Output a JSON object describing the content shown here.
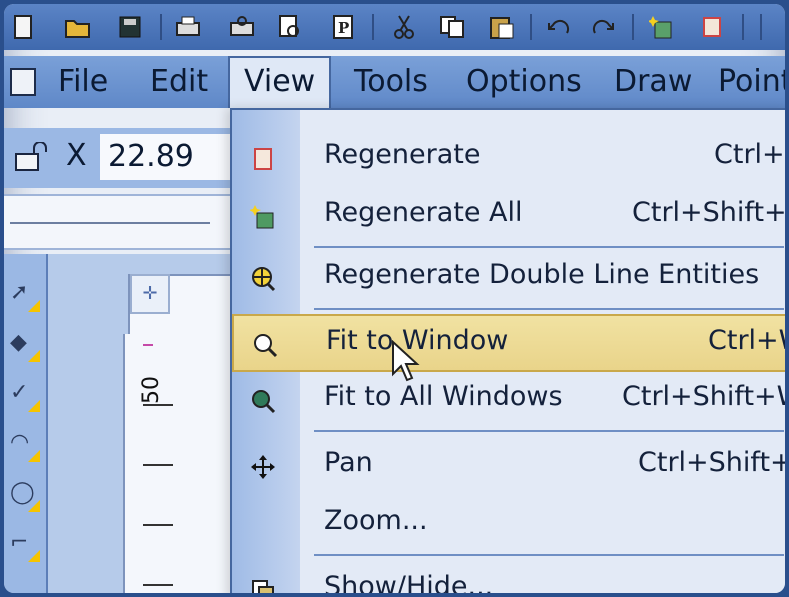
{
  "coordinate": {
    "axis": "X",
    "value": "22.89"
  },
  "menubar": {
    "items": [
      {
        "id": "file",
        "label": "File"
      },
      {
        "id": "edit",
        "label": "Edit"
      },
      {
        "id": "view",
        "label": "View"
      },
      {
        "id": "tools",
        "label": "Tools"
      },
      {
        "id": "options",
        "label": "Options"
      },
      {
        "id": "draw",
        "label": "Draw"
      },
      {
        "id": "point",
        "label": "Point"
      }
    ]
  },
  "toolbar": {
    "buttons": [
      "new-icon",
      "open-icon",
      "save-icon",
      "print-icon",
      "print-preview-icon",
      "page-setup-icon",
      "properties-icon",
      "cut-icon",
      "copy-icon",
      "paste-icon",
      "undo-icon",
      "redo-icon",
      "regenerate-all-icon",
      "regenerate-icon"
    ]
  },
  "ruler": {
    "label": "50"
  },
  "view_menu": {
    "items": [
      {
        "label": "Regenerate",
        "shortcut": "Ctrl+R",
        "icon": "regenerate-icon"
      },
      {
        "label": "Regenerate All",
        "shortcut": "Ctrl+Shift+R",
        "icon": "regenerate-all-icon"
      },
      {
        "label": "Regenerate Double Line Entities",
        "shortcut": "",
        "icon": "regenerate-double-line-icon"
      },
      {
        "label": "Fit to Window",
        "shortcut": "Ctrl+W",
        "icon": "fit-to-window-icon",
        "highlighted": true
      },
      {
        "label": "Fit to All Windows",
        "shortcut": "Ctrl+Shift+W",
        "icon": "fit-to-all-windows-icon"
      },
      {
        "label": "Pan",
        "shortcut": "Ctrl+Shift+P",
        "icon": "pan-icon"
      },
      {
        "label": "Zoom...",
        "shortcut": "",
        "icon": ""
      },
      {
        "label": "Show/Hide...",
        "shortcut": "",
        "icon": "show-hide-icon"
      }
    ]
  },
  "colors": {
    "accent": "#45679f",
    "highlight": "#e9d48a",
    "palette_marker": "#f5c400"
  }
}
